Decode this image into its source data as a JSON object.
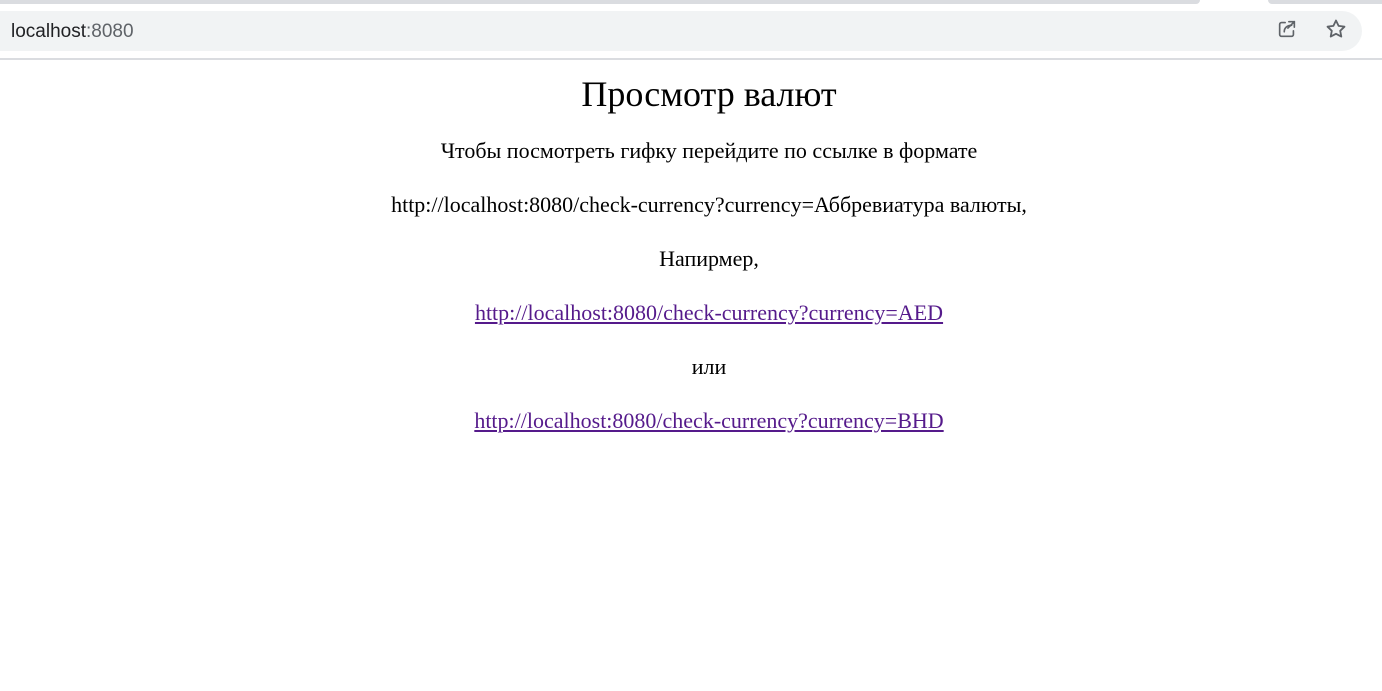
{
  "browser": {
    "url_host": "localhost",
    "url_port": ":8080",
    "share_icon": "share-icon",
    "star_icon": "star-icon"
  },
  "page": {
    "title": "Просмотр валют",
    "instruction": "Чтобы посмотреть гифку перейдите по ссылке в формате",
    "format": "http://localhost:8080/check-currency?currency=Аббревиатура валюты,",
    "example_label": "Напирмер,",
    "link_aed": "http://localhost:8080/check-currency?currency=AED",
    "or_label": "или",
    "link_bhd": "http://localhost:8080/check-currency?currency=BHD"
  },
  "colors": {
    "visited_link": "#551a8b",
    "omnibox_bg": "#f1f3f4"
  }
}
